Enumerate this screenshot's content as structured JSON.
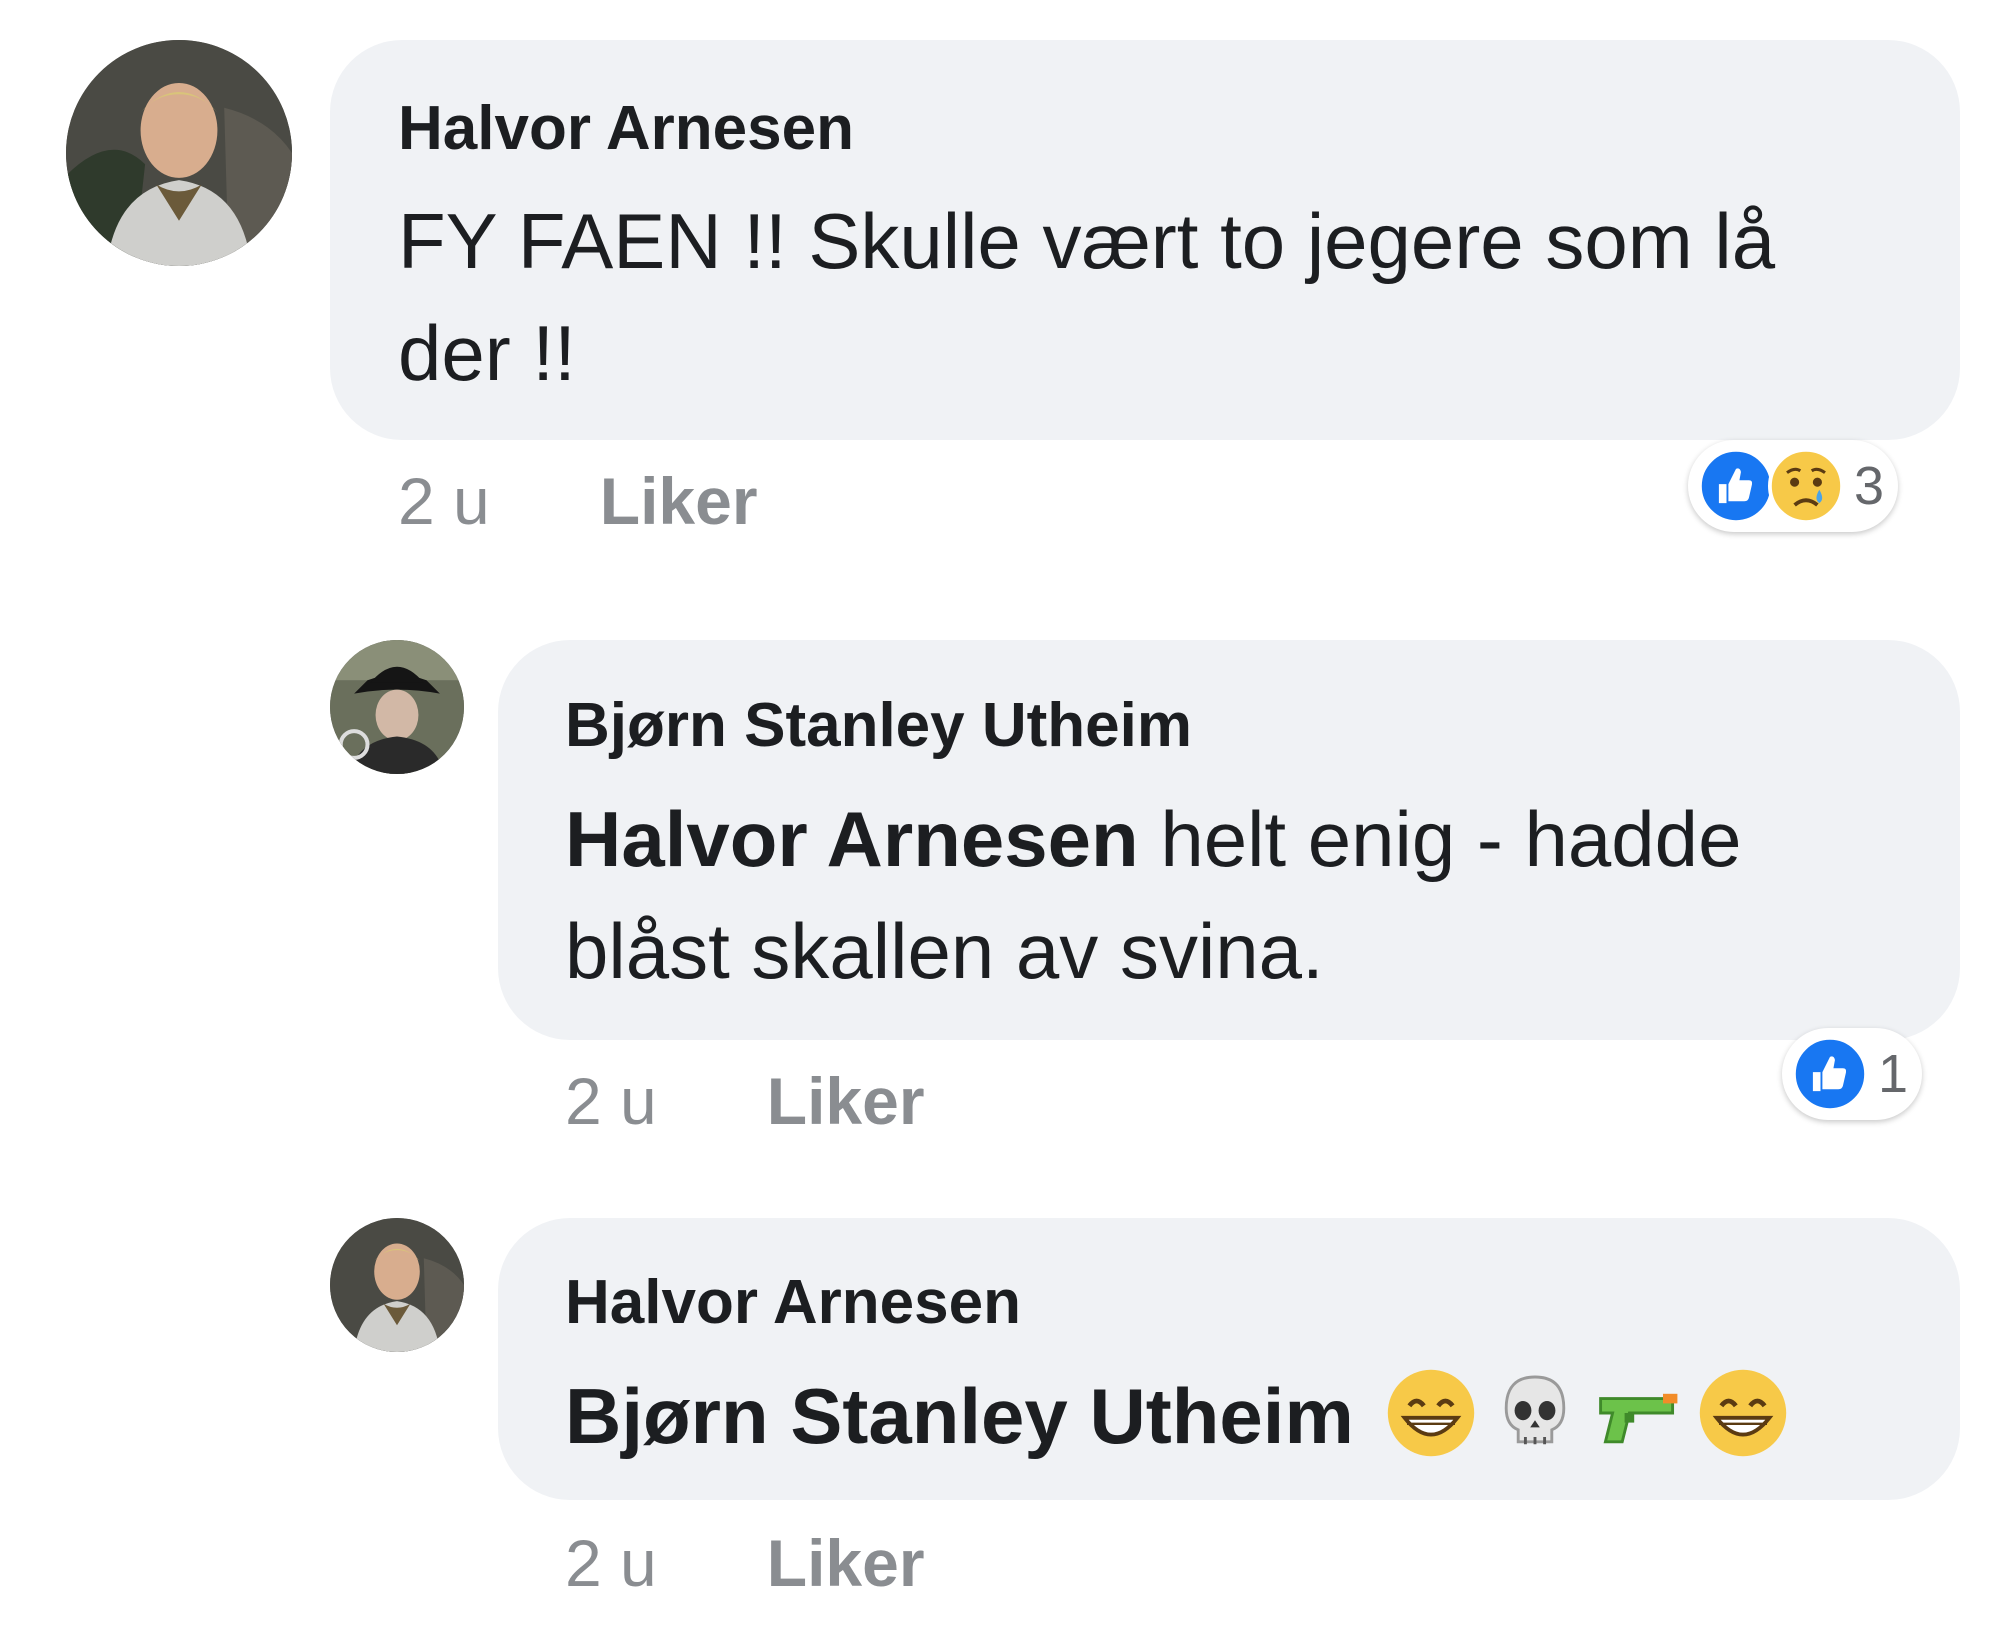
{
  "comments": [
    {
      "author": "Halvor Arnesen",
      "text": "FY FAEN !! Skulle vært to jegere som lå der  !!",
      "time": "2 u",
      "like_label": "Liker",
      "reactions": {
        "icons": [
          "like-icon",
          "sad-icon"
        ],
        "count": "3"
      }
    },
    {
      "author": "Bjørn Stanley Utheim",
      "mention": "Halvor Arnesen",
      "text": " helt enig - hadde blåst skallen av svina.",
      "time": "2 u",
      "like_label": "Liker",
      "reactions": {
        "icons": [
          "like-icon"
        ],
        "count": "1"
      }
    },
    {
      "author": "Halvor Arnesen",
      "mention": "Bjørn Stanley Utheim",
      "emojis": [
        "grinning-face-icon",
        "skull-icon",
        "water-pistol-icon",
        "grinning-face-icon"
      ],
      "time": "2 u",
      "like_label": "Liker"
    }
  ],
  "colors": {
    "bubble": "#f0f2f5",
    "like_blue": "#1877f2",
    "meta_gray": "#8a8d91"
  }
}
